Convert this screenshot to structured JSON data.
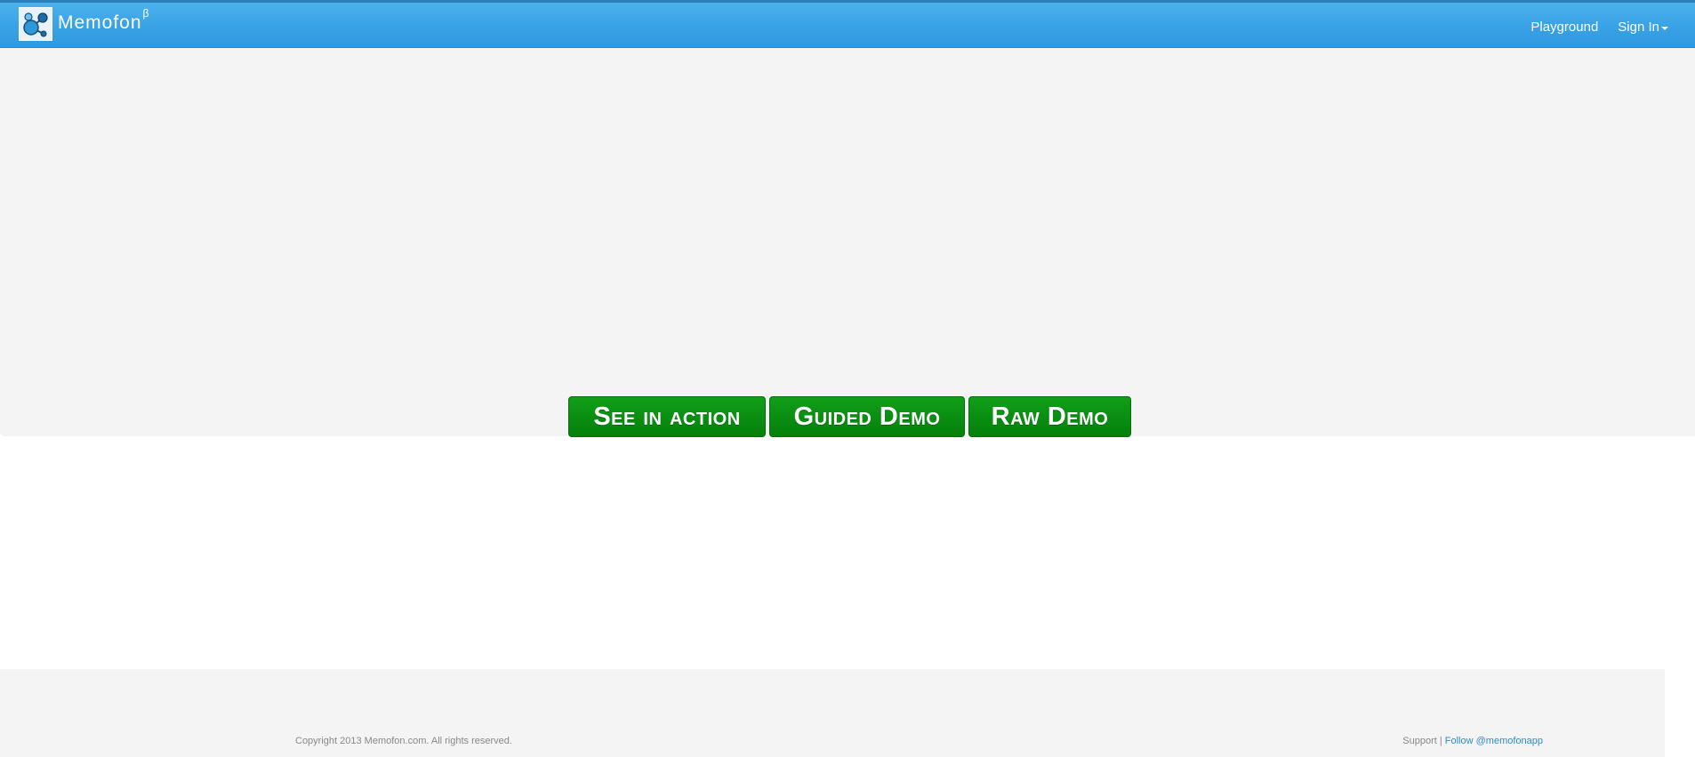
{
  "navbar": {
    "brand_name": "Memofon",
    "brand_sup": "β",
    "logo_icon": "memofon-logo-icon",
    "links": {
      "playground": "Playground",
      "sign_in": "Sign In"
    },
    "accent_color": "#3aa3e6"
  },
  "hero": {
    "buttons": {
      "see_in_action": "See in action",
      "guided_demo": "Guided Demo",
      "raw_demo": "Raw Demo"
    },
    "button_color": "#0a8f12"
  },
  "footer": {
    "copyright": "Copyright 2013 Memofon.com. All rights reserved.",
    "support": "Support",
    "separator": "|",
    "follow": "Follow @memofonapp",
    "link_color": "#2a8cc8"
  }
}
